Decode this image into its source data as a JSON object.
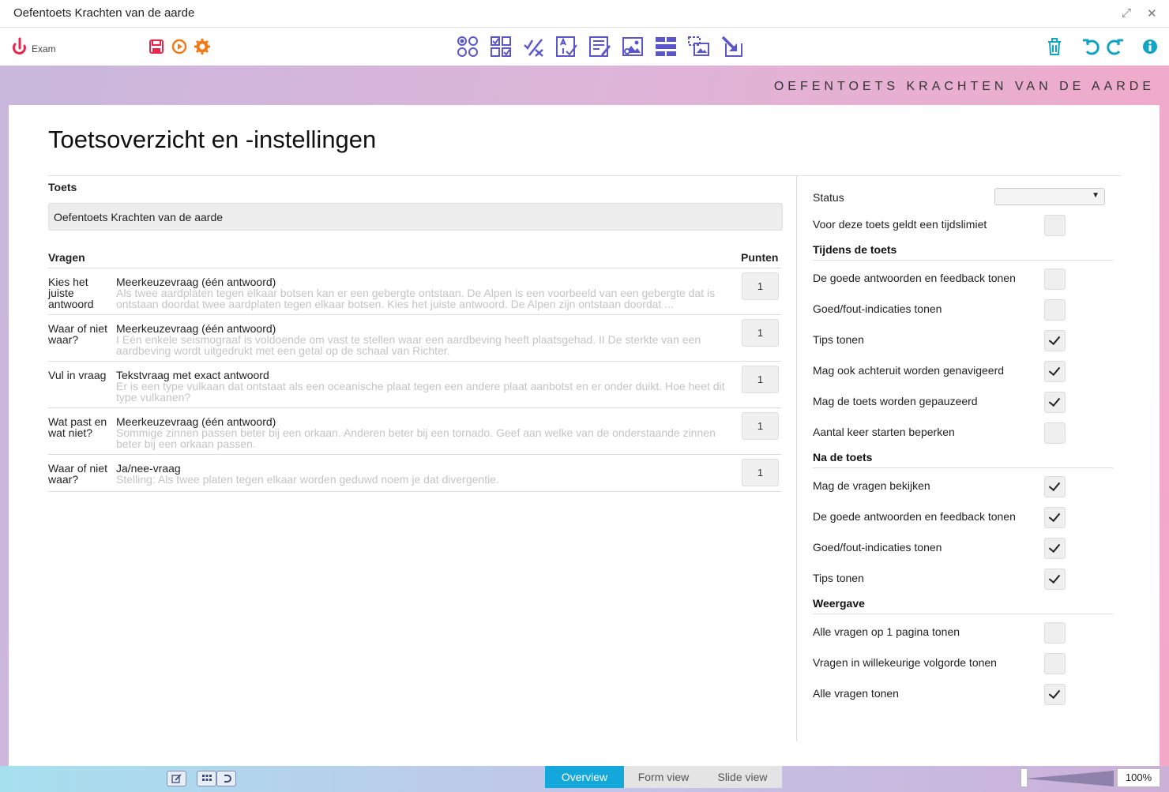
{
  "window": {
    "title": "Oefentoets Krachten van de aarde"
  },
  "toolbar": {
    "brand_label": "Exam"
  },
  "stage": {
    "title": "OEFENTOETS KRACHTEN VAN DE AARDE"
  },
  "page": {
    "heading": "Toetsoverzicht en -instellingen"
  },
  "form": {
    "toets_label": "Toets",
    "toets_value": "Oefentoets Krachten van de aarde",
    "vragen_label": "Vragen",
    "punten_label": "Punten"
  },
  "questions": [
    {
      "category": "Kies het juiste antwoord",
      "type": "Meerkeuzevraag (één antwoord)",
      "description": "Als twee aardplaten tegen elkaar botsen kan er een gebergte ontstaan. De Alpen is een voorbeeld van een gebergte dat is ontstaan doordat twee aardplaten tegen elkaar botsen. Kies het juiste antwoord. De Alpen zijn ontstaan doordat ...",
      "points": "1"
    },
    {
      "category": "Waar of niet waar?",
      "type": "Meerkeuzevraag (één antwoord)",
      "description": "I Eén enkele seismograaf is voldoende om vast te stellen waar een aardbeving heeft plaatsgehad. II De sterkte van een aardbeving wordt uitgedrukt met een getal op de schaal van Richter.",
      "points": "1"
    },
    {
      "category": "Vul in vraag",
      "type": "Tekstvraag met exact antwoord",
      "description": "Er is een type vulkaan dat ontstaat als een oceanische plaat tegen een andere plaat aanbotst en er onder duikt. Hoe heet dit type vulkanen?",
      "points": "1"
    },
    {
      "category": "Wat past en wat niet?",
      "type": "Meerkeuzevraag (één antwoord)",
      "description": "Sommige zinnen passen beter bij een orkaan. Anderen beter bij een tornado. Geef aan welke van de onderstaande zinnen beter bij een orkaan passen.",
      "points": "1"
    },
    {
      "category": "Waar of niet waar?",
      "type": "Ja/nee-vraag",
      "description": "Stelling: Als twee platen tegen elkaar worden geduwd noem je dat divergentie.",
      "points": "1"
    }
  ],
  "settings": {
    "status_label": "Status",
    "status_value": "",
    "time_limit_label": "Voor deze toets geldt een tijdslimiet",
    "during_title": "Tijdens de toets",
    "during": [
      {
        "label": "De goede antwoorden en feedback tonen",
        "checked": false
      },
      {
        "label": "Goed/fout-indicaties tonen",
        "checked": false
      },
      {
        "label": "Tips tonen",
        "checked": true
      },
      {
        "label": "Mag ook achteruit worden genavigeerd",
        "checked": true
      },
      {
        "label": "Mag de toets worden gepauzeerd",
        "checked": true
      },
      {
        "label": "Aantal keer starten beperken",
        "checked": false
      }
    ],
    "after_title": "Na de toets",
    "after": [
      {
        "label": "Mag de vragen bekijken",
        "checked": true
      },
      {
        "label": "De goede antwoorden en feedback tonen",
        "checked": true
      },
      {
        "label": "Goed/fout-indicaties tonen",
        "checked": true
      },
      {
        "label": "Tips tonen",
        "checked": true
      }
    ],
    "display_title": "Weergave",
    "display": [
      {
        "label": "Alle vragen op 1 pagina tonen",
        "checked": false
      },
      {
        "label": "Vragen in willekeurige volgorde tonen",
        "checked": false
      },
      {
        "label": "Alle vragen tonen",
        "checked": true
      }
    ]
  },
  "footer": {
    "tabs": [
      "Overview",
      "Form view",
      "Slide view"
    ],
    "active_tab": "Overview",
    "zoom": "100%"
  },
  "colors": {
    "accent": "#13a8d9",
    "brand_red": "#e8264e",
    "toolbar_purple": "#5b56c9",
    "teal": "#12a4c4",
    "orange": "#f07a18"
  }
}
